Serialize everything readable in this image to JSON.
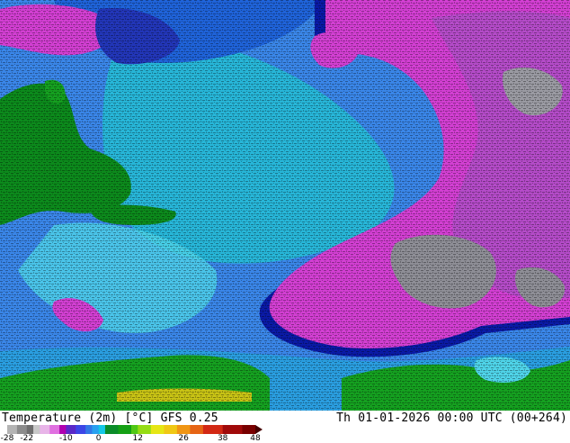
{
  "map": {
    "region": "North Atlantic",
    "field": "2m temperature",
    "colors": {
      "ocean_deep": "#1f63d9",
      "ocean_mid": "#3a86e8",
      "ocean_cool": "#27b6d8",
      "cold_cyan": "#4fd3e8",
      "coast_band": "#0a1aa6",
      "land_warm": "#0c8a1c",
      "tropics": "#15a020",
      "magenta": "#d23fd2",
      "violet": "#b44bc8",
      "gray_cold": "#8e8e96"
    }
  },
  "footer": {
    "title": "Temperature (2m) [°C] GFS 0.25",
    "timestamp": "Th 01-01-2026 00:00 UTC (00+264)"
  },
  "colorbar": {
    "ticks": [
      "-28",
      "-22",
      "-10",
      "0",
      "12",
      "26",
      "38",
      "48"
    ],
    "min": -28,
    "max": 48,
    "stops": [
      {
        "t": -28,
        "color": "#b4b4b4"
      },
      {
        "t": -25,
        "color": "#8c8c8c"
      },
      {
        "t": -22,
        "color": "#6e6e6e"
      },
      {
        "t": -20,
        "color": "#c8c8c8"
      },
      {
        "t": -18,
        "color": "#e8b4e8"
      },
      {
        "t": -15,
        "color": "#e070e0"
      },
      {
        "t": -12,
        "color": "#b000b0"
      },
      {
        "t": -10,
        "color": "#5a28c8"
      },
      {
        "t": -7,
        "color": "#3c46e6"
      },
      {
        "t": -4,
        "color": "#3278e6"
      },
      {
        "t": -2,
        "color": "#28a0f0"
      },
      {
        "t": 0,
        "color": "#14c8e6"
      },
      {
        "t": 2,
        "color": "#0a8c28"
      },
      {
        "t": 6,
        "color": "#14a014"
      },
      {
        "t": 10,
        "color": "#50c814"
      },
      {
        "t": 12,
        "color": "#96dc14"
      },
      {
        "t": 16,
        "color": "#e6e614"
      },
      {
        "t": 20,
        "color": "#f0c814"
      },
      {
        "t": 24,
        "color": "#f09614"
      },
      {
        "t": 28,
        "color": "#e66414"
      },
      {
        "t": 32,
        "color": "#d22814"
      },
      {
        "t": 38,
        "color": "#a00a0a"
      },
      {
        "t": 44,
        "color": "#780000"
      },
      {
        "t": 48,
        "color": "#460000"
      }
    ]
  }
}
